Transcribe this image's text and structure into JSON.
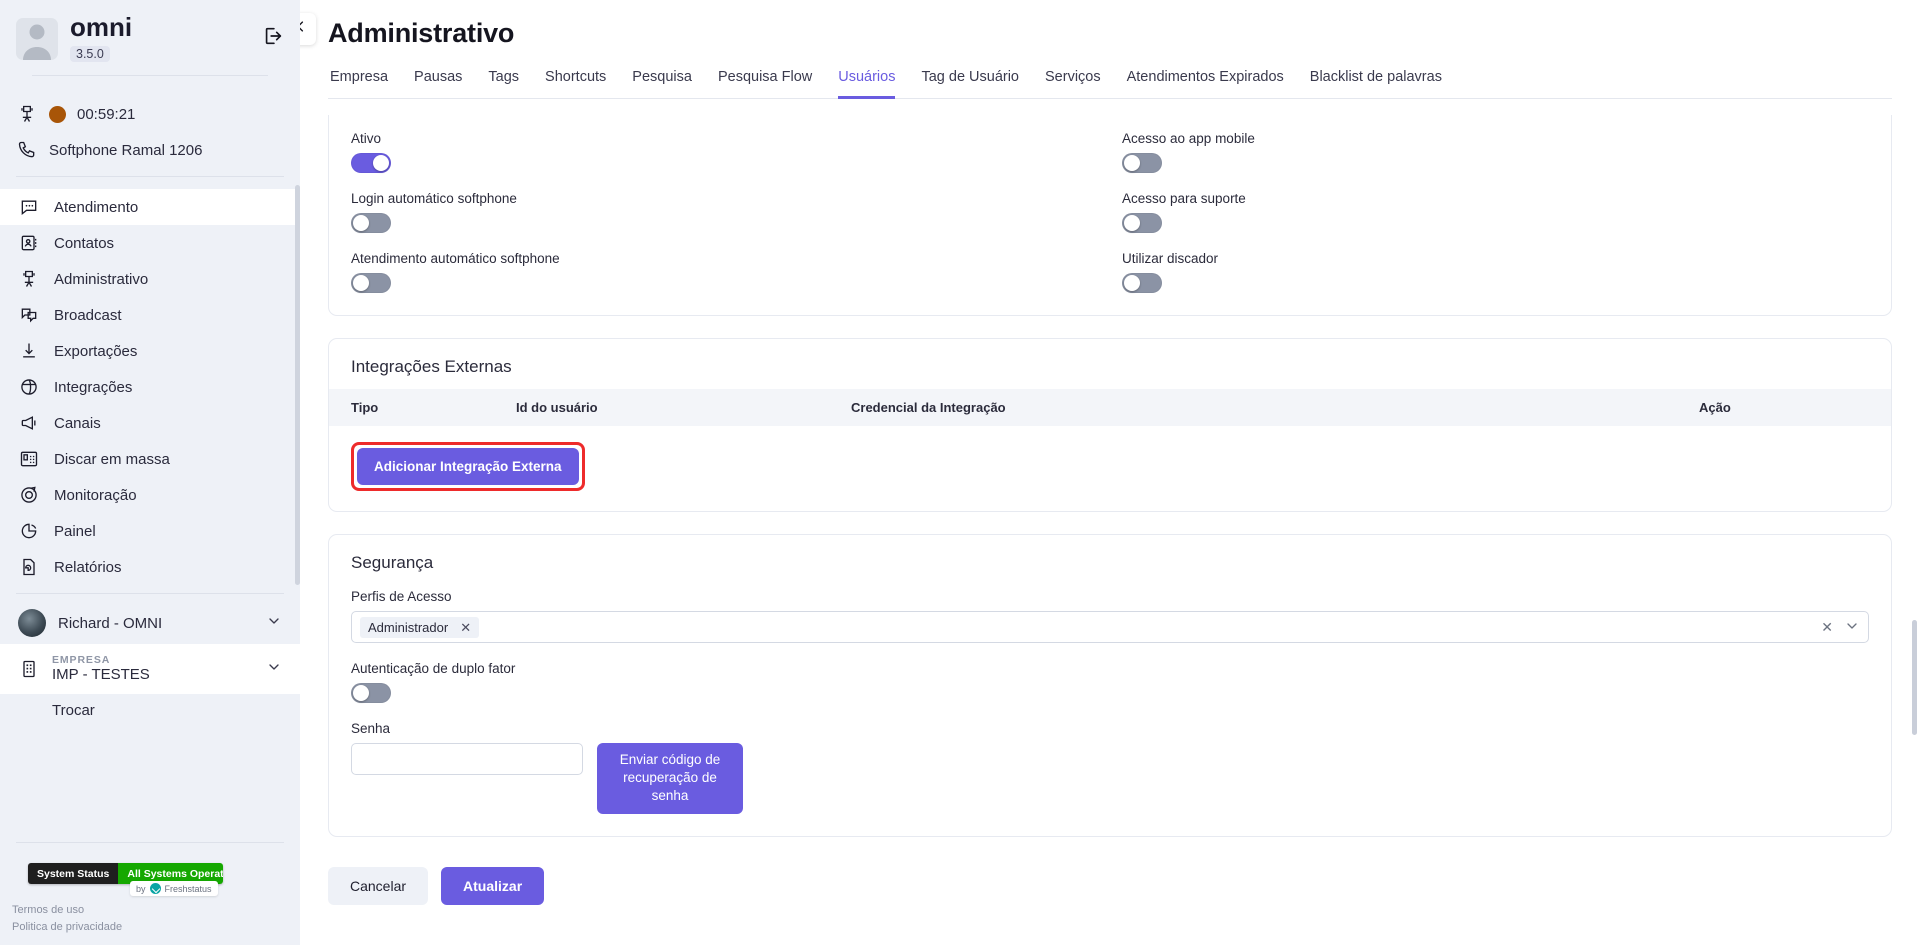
{
  "sidebar": {
    "user": {
      "name": "omni",
      "version": "3.5.0",
      "avatar_icon": "user-avatar-icon",
      "logout_icon": "logout-icon"
    },
    "status": {
      "timer": "00:59:21",
      "timer_icon": "agent-chair-icon",
      "dot_color": "#a85508",
      "softphone": "Softphone Ramal 1206",
      "softphone_icon": "phone-icon"
    },
    "nav": [
      {
        "label": "Atendimento",
        "icon": "chat-bubble-icon",
        "active": true
      },
      {
        "label": "Contatos",
        "icon": "contact-card-icon",
        "active": false
      },
      {
        "label": "Administrativo",
        "icon": "admin-chair-icon",
        "active": false
      },
      {
        "label": "Broadcast",
        "icon": "broadcast-bubbles-icon",
        "active": false
      },
      {
        "label": "Exportações",
        "icon": "download-icon",
        "active": false
      },
      {
        "label": "Integrações",
        "icon": "integrations-globe-icon",
        "active": false
      },
      {
        "label": "Canais",
        "icon": "megaphone-icon",
        "active": false
      },
      {
        "label": "Discar em massa",
        "icon": "deskphone-icon",
        "active": false
      },
      {
        "label": "Monitoração",
        "icon": "target-icon",
        "active": false
      },
      {
        "label": "Painel",
        "icon": "pie-chart-icon",
        "active": false
      },
      {
        "label": "Relatórios",
        "icon": "report-file-icon",
        "active": false
      }
    ],
    "account": {
      "name": "Richard - OMNI",
      "chevron_icon": "chevron-down-icon"
    },
    "company": {
      "label": "EMPRESA",
      "name": "IMP - TESTES",
      "icon": "building-icon",
      "chevron_icon": "chevron-down-icon"
    },
    "switch_label": "Trocar",
    "system_status": {
      "left": "System Status",
      "right": "All Systems Operational",
      "by": "by",
      "provider": "Freshstatus",
      "left_color": "#1f1f1f",
      "right_color": "#15a800"
    },
    "legal": [
      "Termos de uso",
      "Politica de privacidade"
    ]
  },
  "header": {
    "collapse_icon": "chevron-left-icon",
    "title": "Administrativo",
    "tabs": [
      {
        "label": "Empresa",
        "active": false
      },
      {
        "label": "Pausas",
        "active": false
      },
      {
        "label": "Tags",
        "active": false
      },
      {
        "label": "Shortcuts",
        "active": false
      },
      {
        "label": "Pesquisa",
        "active": false
      },
      {
        "label": "Pesquisa Flow",
        "active": false
      },
      {
        "label": "Usuários",
        "active": true
      },
      {
        "label": "Tag de Usuário",
        "active": false
      },
      {
        "label": "Serviços",
        "active": false
      },
      {
        "label": "Atendimentos Expirados",
        "active": false
      },
      {
        "label": "Blacklist de palavras",
        "active": false
      }
    ]
  },
  "toggles_card": {
    "left": [
      {
        "label": "Ativo",
        "on": true
      },
      {
        "label": "Login automático softphone",
        "on": false
      },
      {
        "label": "Atendimento automático softphone",
        "on": false
      }
    ],
    "right": [
      {
        "label": "Acesso ao app mobile",
        "on": false
      },
      {
        "label": "Acesso para suporte",
        "on": false
      },
      {
        "label": "Utilizar discador",
        "on": false
      }
    ]
  },
  "integrations": {
    "title": "Integrações Externas",
    "columns": [
      "Tipo",
      "Id do usuário",
      "Credencial da Integração",
      "Ação"
    ],
    "rows": [],
    "add_button": "Adicionar Integração Externa",
    "add_button_highlighted": true,
    "highlight_color": "#ee2b2b"
  },
  "security": {
    "title": "Segurança",
    "profiles_label": "Perfis de Acesso",
    "profiles_selected": [
      "Administrador"
    ],
    "profiles_chip_remove_icon": "close-icon",
    "profiles_clear_icon": "clear-icon",
    "profiles_chevron_icon": "chevron-down-icon",
    "twofa_label": "Autenticação de duplo fator",
    "twofa_on": false,
    "password_label": "Senha",
    "password_value": "",
    "password_placeholder": "",
    "recover_button": "Enviar código de\nrecuperação de senha",
    "recover_button_line1": "Enviar código de",
    "recover_button_line2": "recuperação de senha"
  },
  "footer": {
    "cancel": "Cancelar",
    "update": "Atualizar"
  },
  "theme": {
    "accent": "#6a5ce0",
    "sidebar_bg": "#eef1f7",
    "toggle_off": "#8b93a5"
  }
}
